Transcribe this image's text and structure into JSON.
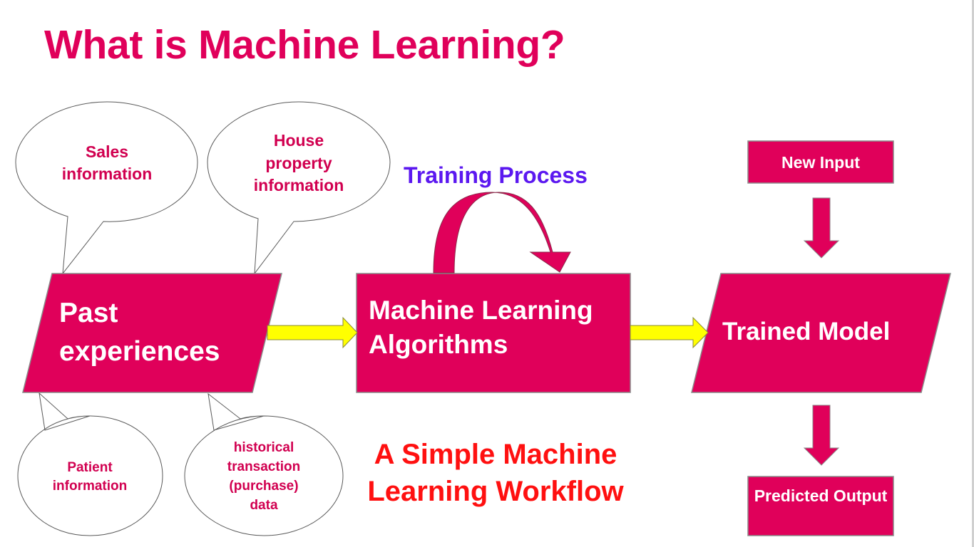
{
  "slide": {
    "title": "What is Machine Learning?",
    "colors": {
      "title": "#e0005a",
      "shape_fill": "#e0005a",
      "shape_stroke": "#8a8a8a",
      "arrow_fill": "#ffff00",
      "arrow_stroke": "#8a8a3a",
      "training_label": "#5b18f0",
      "workflow_label": "#ff1010",
      "bubble_text": "#d10050",
      "shape_text": "#ffffff"
    }
  },
  "bubbles": {
    "sales": "Sales information",
    "house": "House property information",
    "patient": "Patient information",
    "historical": "historical transaction (purchase) data"
  },
  "shapes": {
    "past": "Past experiences",
    "ml_algorithms": "Machine Learning Algorithms",
    "trained_model": "Trained Model",
    "new_input": "New Input",
    "predicted_output": "Predicted Output"
  },
  "labels": {
    "training_process": "Training Process",
    "workflow_caption": "A Simple Machine Learning Workflow"
  }
}
